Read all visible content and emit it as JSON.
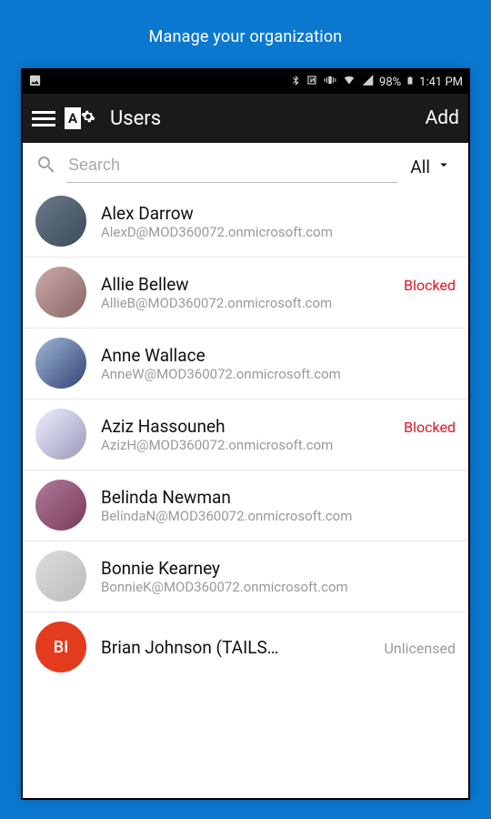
{
  "page": {
    "heading": "Manage your organization"
  },
  "statusbar": {
    "battery": "98%",
    "clock": "1:41 PM"
  },
  "appbar": {
    "title": "Users",
    "add_label": "Add"
  },
  "search": {
    "placeholder": "Search",
    "filter_label": "All"
  },
  "users": [
    {
      "name": "Alex Darrow",
      "email": "AlexD@MOD360072.onmicrosoft.com",
      "status": "",
      "status_kind": "",
      "avatar_bg": "linear-gradient(135deg,#6a7a8a,#3a4a5a)",
      "initials": ""
    },
    {
      "name": "Allie Bellew",
      "email": "AllieB@MOD360072.onmicrosoft.com",
      "status": "Blocked",
      "status_kind": "blocked",
      "avatar_bg": "linear-gradient(135deg,#caa,#866)",
      "initials": ""
    },
    {
      "name": "Anne Wallace",
      "email": "AnneW@MOD360072.onmicrosoft.com",
      "status": "",
      "status_kind": "",
      "avatar_bg": "linear-gradient(135deg,#9fb7d4,#347)",
      "initials": ""
    },
    {
      "name": "Aziz Hassouneh",
      "email": "AzizH@MOD360072.onmicrosoft.com",
      "status": "Blocked",
      "status_kind": "blocked",
      "avatar_bg": "linear-gradient(135deg,#eef,#99b)",
      "initials": ""
    },
    {
      "name": "Belinda Newman",
      "email": "BelindaN@MOD360072.onmicrosoft.com",
      "status": "",
      "status_kind": "",
      "avatar_bg": "linear-gradient(135deg,#b07a99,#7a3a5a)",
      "initials": ""
    },
    {
      "name": "Bonnie Kearney",
      "email": "BonnieK@MOD360072.onmicrosoft.com",
      "status": "",
      "status_kind": "",
      "avatar_bg": "linear-gradient(135deg,#ddd,#bbb)",
      "initials": ""
    },
    {
      "name": "Brian Johnson (TAILS…",
      "email": "",
      "status": "Unlicensed",
      "status_kind": "unlicensed",
      "avatar_bg": "#e33b1e",
      "initials": "BI"
    }
  ]
}
